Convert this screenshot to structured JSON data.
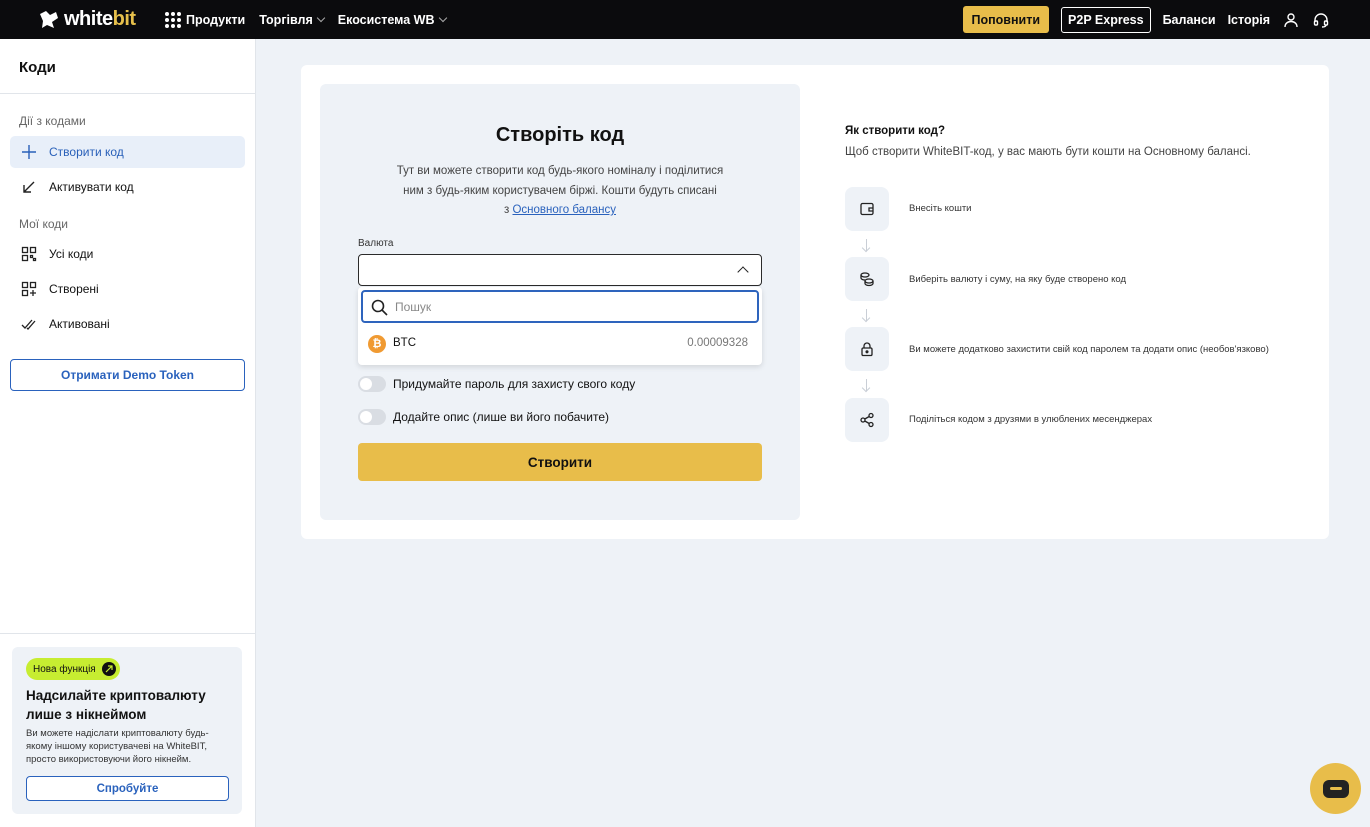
{
  "header": {
    "logo_text_white": "white",
    "logo_text_accent": "bit",
    "nav": [
      "Продукти",
      "Торгівля",
      "Екосистема WB"
    ],
    "deposit_label": "Поповнити",
    "p2p_label": "P2P Express",
    "balances_label": "Баланси",
    "history_label": "Історія"
  },
  "sidebar": {
    "title": "Коди",
    "group1": "Дії з кодами",
    "items1": [
      {
        "label": "Створити код",
        "icon": "plus-icon",
        "active": true
      },
      {
        "label": "Активувати код",
        "icon": "arrow-down-left-icon"
      }
    ],
    "group2": "Мої коди",
    "items2": [
      {
        "label": "Усі коди",
        "icon": "qr-icon"
      },
      {
        "label": "Створені",
        "icon": "grid-plus-icon"
      },
      {
        "label": "Активовані",
        "icon": "double-check-icon"
      }
    ],
    "demo_button": "Отримати Demo Token"
  },
  "promo": {
    "badge": "Нова функція",
    "title": "Надсилайте криптовалюту лише з нікнеймом",
    "text": "Ви можете надіслати криптовалюту будь-якому іншому користувачеві на WhiteBIT, просто використовуючи його нікнейм.",
    "button": "Спробуйте"
  },
  "form": {
    "title": "Створіть код",
    "desc_line1": "Тут ви можете створити код будь-якого номіналу і поділитися",
    "desc_line2": "ним з будь-яким користувачем біржі. Кошти будуть списані",
    "desc_prefix": "з",
    "desc_link": "Основного балансу",
    "currency_label": "Валюта",
    "search_placeholder": "Пошук",
    "coin": {
      "name": "BTC",
      "balance": "0.00009328"
    },
    "toggle_password": "Придумайте пароль для захисту свого коду",
    "toggle_description": "Додайте опис (лише ви його побачите)",
    "create_button": "Створити"
  },
  "info": {
    "title": "Як створити код?",
    "desc": "Щоб створити WhiteBIT-код, у вас мають бути кошти на Основному балансі.",
    "steps": [
      {
        "text": "Внесіть кошти",
        "icon": "wallet-icon"
      },
      {
        "text": "Виберіть валюту і суму, на яку буде створено код",
        "icon": "coins-icon"
      },
      {
        "text": "Ви можете додатково захистити свій код паролем та додати опис (необов'язково)",
        "icon": "lock-icon"
      },
      {
        "text": "Поділіться кодом з друзями в улюблених месенджерах",
        "icon": "share-icon"
      }
    ]
  },
  "colors": {
    "accent": "#e8bd4a",
    "link": "#2a62bd",
    "topbar": "#0b0b0d",
    "badge": "#c7ed31",
    "btc": "#f09a32"
  }
}
